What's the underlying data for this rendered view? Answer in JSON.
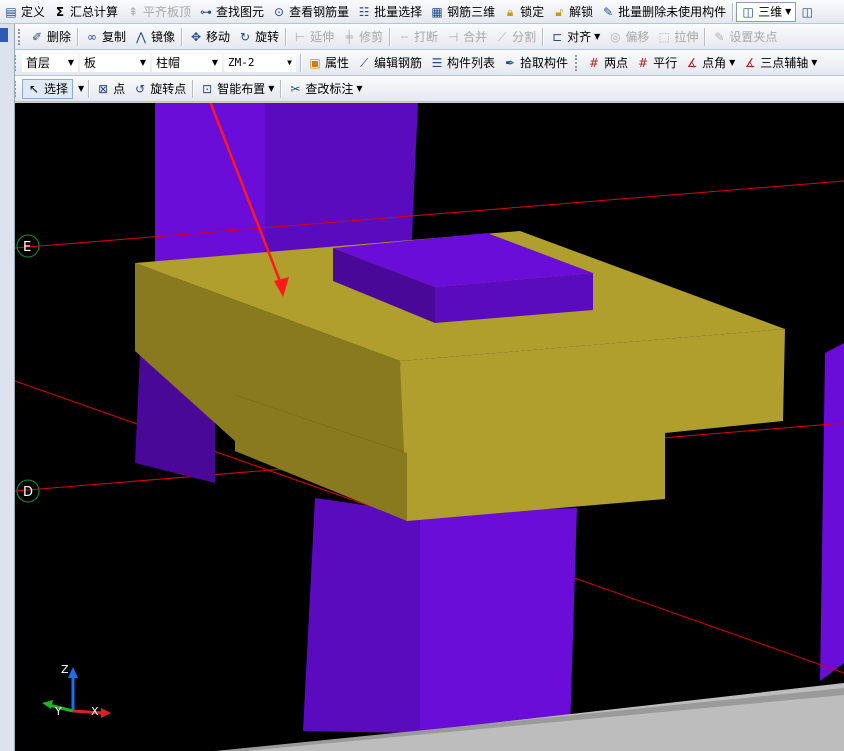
{
  "toolbar1": {
    "items": [
      {
        "label": "定义",
        "icon": "define-icon",
        "enabled": true
      },
      {
        "label": "汇总计算",
        "icon": "sigma-icon",
        "enabled": true
      },
      {
        "label": "平齐板顶",
        "icon": "flush-slab-icon",
        "enabled": false
      },
      {
        "label": "查找图元",
        "icon": "binoculars-icon",
        "enabled": true
      },
      {
        "label": "查看钢筋量",
        "icon": "rebar-view-icon",
        "enabled": true
      },
      {
        "label": "批量选择",
        "icon": "batch-select-icon",
        "enabled": true
      },
      {
        "label": "钢筋三维",
        "icon": "rebar-3d-icon",
        "enabled": true
      },
      {
        "label": "锁定",
        "icon": "lock-icon",
        "enabled": true
      },
      {
        "label": "解锁",
        "icon": "unlock-icon",
        "enabled": true
      },
      {
        "label": "批量删除未使用构件",
        "icon": "batch-delete-icon",
        "enabled": true
      }
    ],
    "view_mode": "三维"
  },
  "toolbar2": {
    "items": [
      {
        "label": "删除",
        "icon": "delete-icon",
        "enabled": true
      },
      {
        "label": "复制",
        "icon": "copy-icon",
        "enabled": true
      },
      {
        "label": "镜像",
        "icon": "mirror-icon",
        "enabled": true
      },
      {
        "label": "移动",
        "icon": "move-icon",
        "enabled": true
      },
      {
        "label": "旋转",
        "icon": "rotate-icon",
        "enabled": true
      },
      {
        "label": "延伸",
        "icon": "extend-icon",
        "enabled": false
      },
      {
        "label": "修剪",
        "icon": "trim-icon",
        "enabled": false
      },
      {
        "label": "打断",
        "icon": "break-icon",
        "enabled": false
      },
      {
        "label": "合并",
        "icon": "merge-icon",
        "enabled": false
      },
      {
        "label": "分割",
        "icon": "split-icon",
        "enabled": false
      },
      {
        "label": "对齐",
        "icon": "align-icon",
        "enabled": true,
        "dropdown": true
      },
      {
        "label": "偏移",
        "icon": "offset-icon",
        "enabled": false
      },
      {
        "label": "拉伸",
        "icon": "stretch-icon",
        "enabled": false
      },
      {
        "label": "设置夹点",
        "icon": "grip-point-icon",
        "enabled": false
      }
    ]
  },
  "toolbar3": {
    "floor": "首层",
    "category": "板",
    "component_type": "柱帽",
    "component_name": "ZM-2",
    "items": [
      {
        "label": "属性",
        "icon": "properties-icon"
      },
      {
        "label": "编辑钢筋",
        "icon": "edit-rebar-icon"
      },
      {
        "label": "构件列表",
        "icon": "component-list-icon"
      },
      {
        "label": "拾取构件",
        "icon": "pick-component-icon"
      },
      {
        "label": "两点",
        "icon": "two-point-axis-icon"
      },
      {
        "label": "平行",
        "icon": "parallel-axis-icon"
      },
      {
        "label": "点角",
        "icon": "point-angle-icon",
        "dropdown": true
      },
      {
        "label": "三点辅轴",
        "icon": "three-point-axis-icon",
        "dropdown": true
      }
    ]
  },
  "toolbar4": {
    "items": [
      {
        "label": "选择",
        "icon": "cursor-icon",
        "dropdown": true,
        "pressed": true
      },
      {
        "label": "点",
        "icon": "point-icon"
      },
      {
        "label": "旋转点",
        "icon": "rotate-point-icon"
      },
      {
        "label": "智能布置",
        "icon": "smart-layout-icon",
        "dropdown": true
      },
      {
        "label": "查改标注",
        "icon": "edit-annotation-icon",
        "dropdown": true
      }
    ]
  },
  "viewport": {
    "grid_labels": [
      "E",
      "D"
    ],
    "axis_labels": {
      "z": "Z",
      "y": "Y",
      "x": "X"
    },
    "colors": {
      "background": "#000000",
      "column": "#6a0dd8",
      "column_dark": "#4a0899",
      "column_cap": "#b09f2c",
      "column_cap_dark": "#8a7a1f",
      "grid_line": "#e00000",
      "grid_marker": "#009a3a",
      "annotation_arrow": "#ff1a1a",
      "floor_slab": "#bdbdbd"
    }
  }
}
